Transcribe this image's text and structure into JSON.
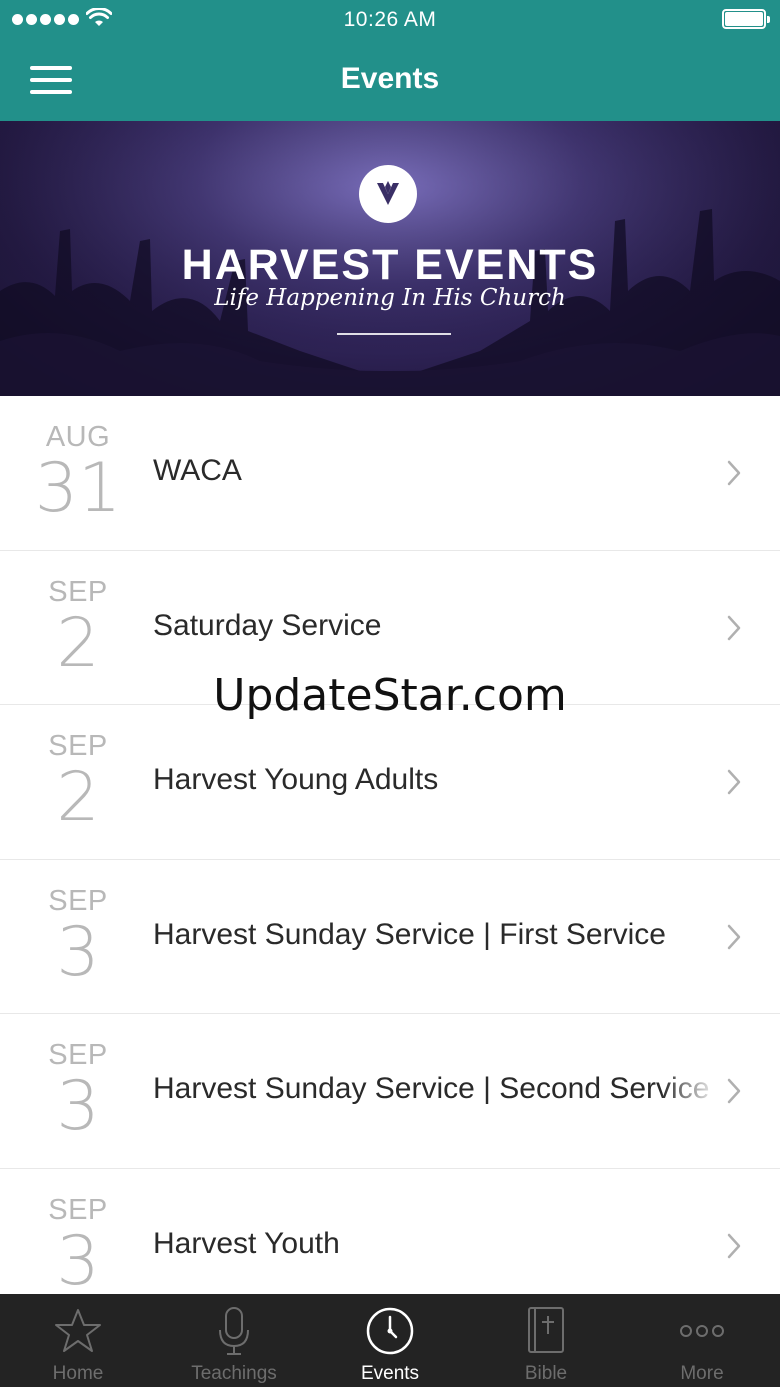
{
  "status_bar": {
    "time": "10:26 AM"
  },
  "nav": {
    "title": "Events"
  },
  "banner": {
    "title": "HARVEST EVENTS",
    "subtitle": "Life Happening In His Church"
  },
  "events": [
    {
      "month": "AUG",
      "day": "31",
      "title": "WACA"
    },
    {
      "month": "SEP",
      "day": "2",
      "title": "Saturday Service"
    },
    {
      "month": "SEP",
      "day": "2",
      "title": "Harvest Young Adults"
    },
    {
      "month": "SEP",
      "day": "3",
      "title": "Harvest Sunday Service | First Service"
    },
    {
      "month": "SEP",
      "day": "3",
      "title": "Harvest Sunday Service | Second Service"
    },
    {
      "month": "SEP",
      "day": "3",
      "title": "Harvest Youth"
    }
  ],
  "watermark": "UpdateStar.com",
  "tabs": [
    {
      "label": "Home",
      "icon": "star-icon"
    },
    {
      "label": "Teachings",
      "icon": "microphone-icon"
    },
    {
      "label": "Events",
      "icon": "clock-icon",
      "active": true
    },
    {
      "label": "Bible",
      "icon": "bible-icon"
    },
    {
      "label": "More",
      "icon": "more-dots-icon"
    }
  ],
  "colors": {
    "header": "#22908a",
    "tabbar": "#232323",
    "muted": "#b8b8b8"
  }
}
